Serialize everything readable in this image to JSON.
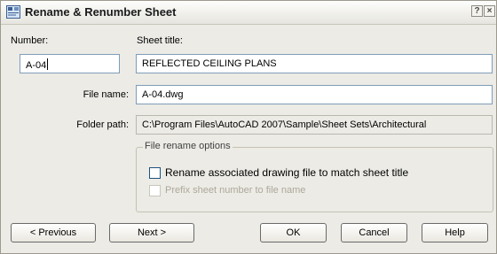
{
  "window": {
    "title": "Rename & Renumber Sheet",
    "icon": "sheet-icon",
    "help_glyph": "?",
    "close_glyph": "×"
  },
  "fields": {
    "number_label": "Number:",
    "number_value": "A-04",
    "sheet_title_label": "Sheet title:",
    "sheet_title_value": "REFLECTED CEILING PLANS",
    "file_name_label": "File name:",
    "file_name_value": "A-04.dwg",
    "folder_path_label": "Folder path:",
    "folder_path_value": "C:\\Program Files\\AutoCAD 2007\\Sample\\Sheet Sets\\Architectural"
  },
  "rename_options": {
    "group_title": "File rename options",
    "rename_drawing_label": "Rename associated drawing file to match sheet title",
    "rename_drawing_checked": false,
    "prefix_label": "Prefix sheet number to file name",
    "prefix_checked": false,
    "prefix_enabled": false
  },
  "buttons": {
    "previous": "< Previous",
    "next": "Next >",
    "ok": "OK",
    "cancel": "Cancel",
    "help": "Help"
  },
  "colors": {
    "dialog_bg": "#ecebe6",
    "input_border": "#7f9db9",
    "checkbox_border": "#1c5180",
    "disabled_text": "#aca899"
  }
}
